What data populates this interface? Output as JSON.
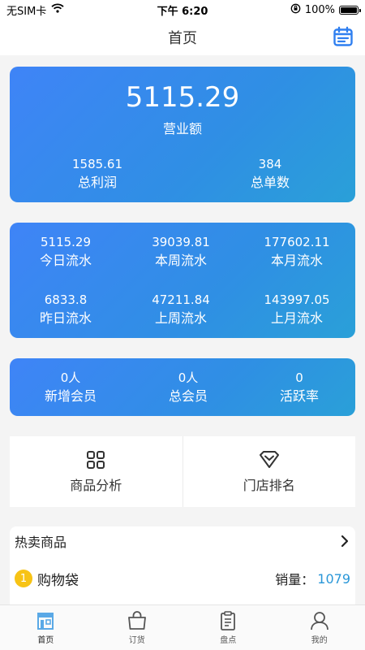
{
  "status": {
    "carrier": "无SIM卡",
    "time": "下午 6:20",
    "battery": "100%",
    "icons": [
      "wifi-icon",
      "orientation-lock-icon",
      "battery-icon"
    ]
  },
  "nav": {
    "title": "首页",
    "calendar_icon": "calendar-icon"
  },
  "revenue_card": {
    "total": "5115.29",
    "total_label": "营业额",
    "profit": "1585.61",
    "profit_label": "总利润",
    "orders": "384",
    "orders_label": "总单数"
  },
  "flow_card": {
    "items": [
      {
        "value": "5115.29",
        "label": "今日流水"
      },
      {
        "value": "39039.81",
        "label": "本周流水"
      },
      {
        "value": "177602.11",
        "label": "本月流水"
      },
      {
        "value": "6833.8",
        "label": "昨日流水"
      },
      {
        "value": "47211.84",
        "label": "上周流水"
      },
      {
        "value": "143997.05",
        "label": "上月流水"
      }
    ]
  },
  "member_card": {
    "items": [
      {
        "value": "0人",
        "label": "新增会员"
      },
      {
        "value": "0人",
        "label": "总会员"
      },
      {
        "value": "0",
        "label": "活跃率"
      }
    ]
  },
  "quick": {
    "items": [
      {
        "label": "商品分析",
        "icon": "grid-icon"
      },
      {
        "label": "门店排名",
        "icon": "diamond-icon"
      }
    ]
  },
  "hot": {
    "title": "热卖商品",
    "items": [
      {
        "rank": "1",
        "name": "购物袋",
        "sales_label": "销量：",
        "sales": "1079"
      }
    ]
  },
  "tabs": [
    {
      "label": "首页",
      "icon": "store-icon"
    },
    {
      "label": "订货",
      "icon": "shopping-bag-icon"
    },
    {
      "label": "盘点",
      "icon": "clipboard-icon"
    },
    {
      "label": "我的",
      "icon": "user-icon"
    }
  ],
  "colors": {
    "accent": "#2f8fe4",
    "card_gradient_start": "#3f84f7",
    "card_gradient_end": "#2aa0d8",
    "rank_badge": "#f7c315",
    "sales_value": "#2a97d8"
  }
}
